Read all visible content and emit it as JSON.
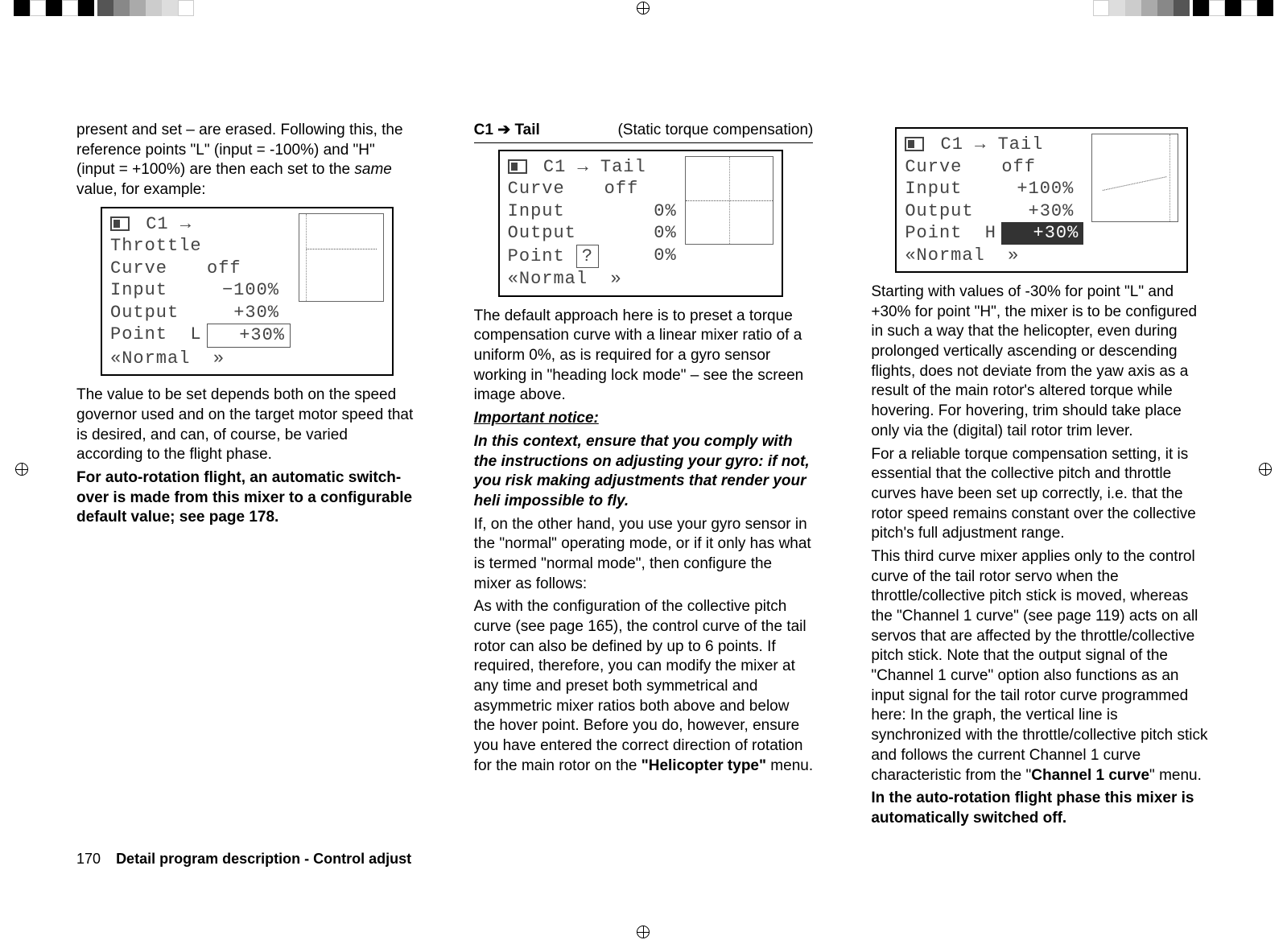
{
  "col1": {
    "p1": "present and set – are erased. Following this, the reference points \"L\" (input = -100%) and \"H\" (input = +100%) are then each set to the ",
    "p1_ital": "same",
    "p1_tail": " value, for example:",
    "display": {
      "title_pre": "C1",
      "title_arrow": "→",
      "title": "Throttle",
      "curve_k": "Curve",
      "curve_v": "off",
      "input_k": "Input",
      "input_v": "−100%",
      "output_k": "Output",
      "output_v": "+30%",
      "point_k": "Point",
      "point_id": "L",
      "point_v": "+30%",
      "footer_l": "«Normal",
      "footer_r": "»"
    },
    "p2": "The value to be set depends both on the speed governor used and on the target motor speed that is desired, and can, of course, be varied according to the flight phase.",
    "p3": "For auto-rotation flight, an automatic switch-over is made from this mixer to a configurable default value; see page 178."
  },
  "col2": {
    "heading_left": "C1 ➔ Tail",
    "heading_right": "(Static torque compensation)",
    "display": {
      "title_pre": "C1",
      "title_arrow": "→",
      "title": "Tail",
      "curve_k": "Curve",
      "curve_v": "off",
      "input_k": "Input",
      "input_v": "0%",
      "output_k": "Output",
      "output_v": "0%",
      "point_k": "Point",
      "point_id": "?",
      "point_v": "0%",
      "footer_l": "«Normal",
      "footer_r": "»"
    },
    "p1": "The default approach here is to preset a torque compensation curve with a linear mixer ratio of a uniform 0%, as is required for a gyro sensor working in \"heading lock mode\" – see the screen image above.",
    "notice_h": "Important notice:",
    "notice_b": "In this context, ensure that you comply with the instructions on adjusting your gyro: if not, you risk making adjustments that render your heli impossible to fly.",
    "p2": "If, on the other hand, you use your gyro sensor in the \"normal\" operating mode, or if it only has what is termed \"normal mode\", then configure the mixer as follows:",
    "p3a": "As with the configuration of the collective pitch curve (see page 165), the control curve of the tail rotor can also be defined by up to 6 points. If required, therefore, you can modify the mixer at any time and preset both symmetrical and asymmetric mixer ratios both above and below the hover point. Before you do, however, ensure you have entered the correct direction of rotation for the main rotor on the ",
    "p3b": "\"Helicopter type\"",
    "p3c": " menu."
  },
  "col3": {
    "display": {
      "title_pre": "C1",
      "title_arrow": "→",
      "title": "Tail",
      "curve_k": "Curve",
      "curve_v": "off",
      "input_k": "Input",
      "input_v": "+100%",
      "output_k": "Output",
      "output_v": "+30%",
      "point_k": "Point",
      "point_id": "H",
      "point_v": "+30%",
      "footer_l": "«Normal",
      "footer_r": "»"
    },
    "p1": "Starting with values of -30% for point \"L\" and +30% for point \"H\", the mixer is to be configured in such a way that the helicopter, even during prolonged vertically ascending or descending flights, does not deviate from the yaw axis as a result of the main rotor's altered torque while hovering. For hovering, trim should take place only via the (digital) tail rotor trim lever.",
    "p2": "For a reliable torque compensation setting, it is essential that the collective pitch and throttle curves have been set up correctly, i.e. that the rotor speed remains constant over the collective pitch's full adjustment range.",
    "p3a": "This third curve mixer applies only to the control curve of the tail rotor servo when the throttle/collective pitch stick is moved, whereas the \"Channel 1 curve\" (see page 119) acts on all servos that are affected by the throttle/collective pitch stick. Note that the output signal of the \"Channel 1 curve\" option also functions as an input signal for the tail rotor curve programmed here: In the graph, the vertical line is synchronized with the throttle/collective pitch stick and follows the current Channel 1 curve characteristic from the \"",
    "p3b": "Channel 1 curve",
    "p3c": "\" menu.",
    "p4": "In the auto-rotation flight phase this mixer is automatically switched off."
  },
  "footer": {
    "page": "170",
    "title": "Detail program description - Control adjust"
  }
}
